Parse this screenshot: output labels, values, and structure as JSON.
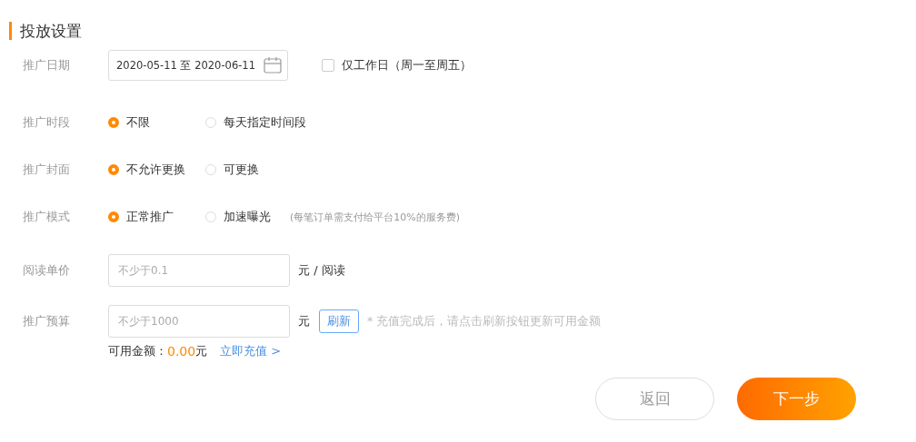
{
  "section_title": "投放设置",
  "date_row": {
    "label": "推广日期",
    "value": "2020-05-11 至 2020-06-11",
    "workdays": {
      "label": "仅工作日（周一至周五）",
      "checked": false
    }
  },
  "radio_rows": [
    {
      "label": "推广时段",
      "options": [
        {
          "label": "不限",
          "selected": true
        },
        {
          "label": "每天指定时间段",
          "selected": false
        }
      ]
    },
    {
      "label": "推广封面",
      "options": [
        {
          "label": "不允许更换",
          "selected": true
        },
        {
          "label": "可更换",
          "selected": false
        }
      ]
    },
    {
      "label": "推广模式",
      "options": [
        {
          "label": "正常推广",
          "selected": true
        },
        {
          "label": "加速曝光",
          "selected": false
        }
      ],
      "note": "(每笔订单需支付给平台10%的服务费)"
    }
  ],
  "price_row": {
    "label": "阅读单价",
    "placeholder": "不少于0.1",
    "unit": "元 / 阅读"
  },
  "budget_row": {
    "label": "推广预算",
    "placeholder": "不少于1000",
    "unit": "元",
    "refresh": "刷新",
    "hint": "* 充值完成后，请点击刷新按钮更新可用金额"
  },
  "balance": {
    "label": "可用金额：",
    "amount": "0.00",
    "currency": "元",
    "link": "立即充值 >"
  },
  "buttons": {
    "back": "返回",
    "next": "下一步"
  }
}
